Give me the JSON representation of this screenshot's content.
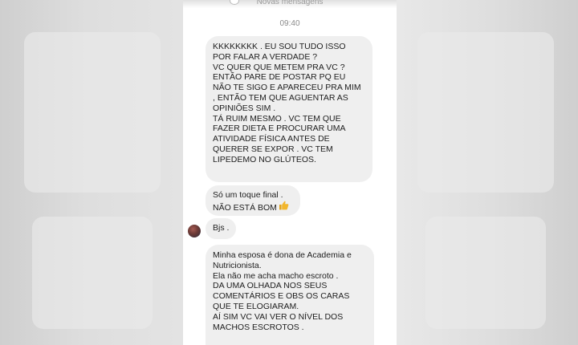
{
  "header": {
    "new_messages_label": "Novas mensagens",
    "timestamp": "09:40"
  },
  "messages": [
    {
      "lines": [
        "KKKKKKKK . EU SOU TUDO ISSO",
        "POR FALAR A VERDADE ?",
        "VC QUER QUE METEM PRA VC ?",
        "ENTÃO PARE DE POSTAR PQ EU",
        "NÃO TE SIGO E APARECEU PRA MIM",
        ", ENTÃO TEM QUE AGUENTAR AS",
        "OPINIÕES SIM .",
        "TÁ RUIM MESMO . VC TEM QUE",
        "FAZER DIETA E PROCURAR UMA",
        "ATIVIDADE FÍSICA ANTES DE",
        "QUERER SE EXPOR . VC TEM",
        "LIPEDEMO NO GLÚTEOS."
      ]
    },
    {
      "lines": [
        "Só um toque final .",
        "NÃO ESTÁ BOM"
      ],
      "emoji_icon": "thumbs-up-icon"
    },
    {
      "lines": [
        "Bjs ."
      ]
    },
    {
      "lines": [
        "Minha esposa é dona de Academia e",
        "Nutricionista.",
        "Ela não me acha macho escroto .",
        "DA UMA OLHADA NOS SEUS",
        "COMENTÁRIOS E OBS OS CARAS",
        "QUE TE ELOGIARAM.",
        "AÍ SIM VC VAI VER O NÍVEL DOS",
        "MACHOS ESCROTOS ."
      ]
    }
  ],
  "colors": {
    "bubble": "#efefef",
    "text": "#1d1d1d",
    "thumb": "#f2b62c"
  }
}
